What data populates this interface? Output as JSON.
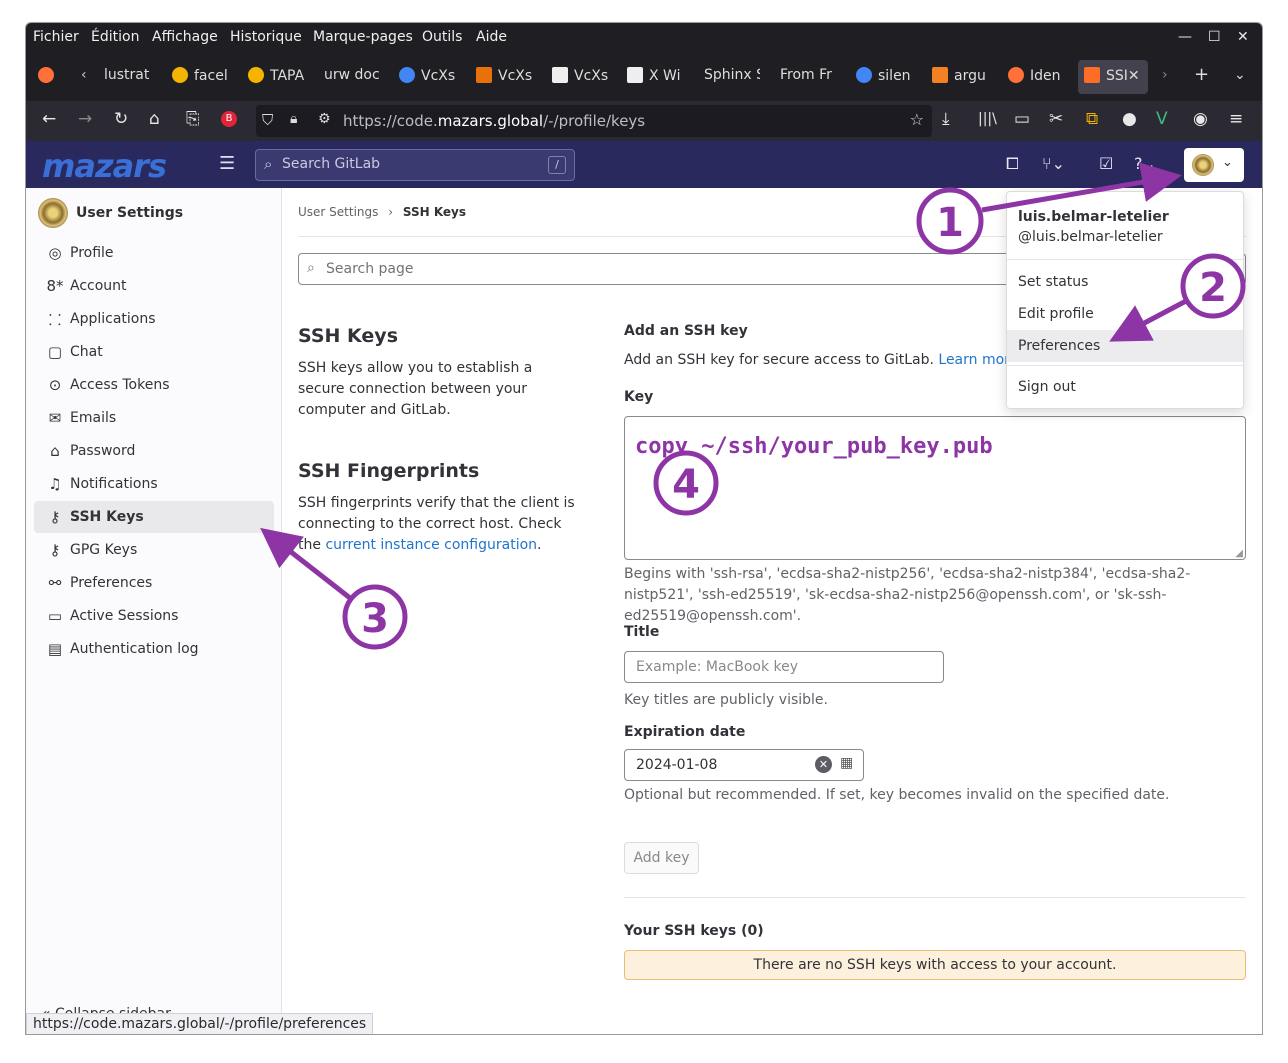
{
  "menubar": {
    "items": [
      "Fichier",
      "Édition",
      "Affichage",
      "Historique",
      "Marque-pages",
      "Outils",
      "Aide"
    ]
  },
  "tabs": [
    {
      "label": "lustrat"
    },
    {
      "label": "facel"
    },
    {
      "label": "TAPA"
    },
    {
      "label": "urw doc"
    },
    {
      "label": "VcXs"
    },
    {
      "label": "VcXs"
    },
    {
      "label": "VcXs"
    },
    {
      "label": "X Wi"
    },
    {
      "label": "Sphinx S"
    },
    {
      "label": "From Fr"
    },
    {
      "label": "silen"
    },
    {
      "label": "argu"
    },
    {
      "label": "Iden"
    },
    {
      "label": "SSI"
    }
  ],
  "url": {
    "prefix": "https://code.",
    "domain": "mazars.global",
    "path": "/-/profile/keys"
  },
  "gitlab": {
    "logo": "mazars",
    "search_placeholder": "Search GitLab",
    "search_shortcut": "/"
  },
  "sidebar": {
    "title": "User Settings",
    "items": [
      {
        "label": "Profile",
        "icon": "user-icon"
      },
      {
        "label": "Account",
        "icon": "account-icon"
      },
      {
        "label": "Applications",
        "icon": "applications-icon"
      },
      {
        "label": "Chat",
        "icon": "chat-icon"
      },
      {
        "label": "Access Tokens",
        "icon": "token-icon"
      },
      {
        "label": "Emails",
        "icon": "email-icon"
      },
      {
        "label": "Password",
        "icon": "lock-icon"
      },
      {
        "label": "Notifications",
        "icon": "bell-icon"
      },
      {
        "label": "SSH Keys",
        "icon": "key-icon"
      },
      {
        "label": "GPG Keys",
        "icon": "key-icon"
      },
      {
        "label": "Preferences",
        "icon": "preferences-icon"
      },
      {
        "label": "Active Sessions",
        "icon": "monitor-icon"
      },
      {
        "label": "Authentication log",
        "icon": "log-icon"
      }
    ],
    "collapse": "Collapse sidebar"
  },
  "breadcrumb": {
    "parent": "User Settings",
    "sep": "›",
    "current": "SSH Keys"
  },
  "search_page": "Search page",
  "ssh_keys_section": {
    "title": "SSH Keys",
    "desc": "SSH keys allow you to establish a secure connection between your computer and GitLab."
  },
  "fingerprints_section": {
    "title": "SSH Fingerprints",
    "desc": "SSH fingerprints verify that the client is connecting to the correct host. Check the",
    "link": "current instance configuration",
    "suffix": "."
  },
  "form": {
    "add_title": "Add an SSH key",
    "add_desc": "Add an SSH key for secure access to GitLab.",
    "learn_more": "Learn more.",
    "key_label": "Key",
    "key_value": "copy ~/ssh/your_pub_key.pub",
    "key_help": "Begins with 'ssh-rsa', 'ecdsa-sha2-nistp256', 'ecdsa-sha2-nistp384', 'ecdsa-sha2-nistp521', 'ssh-ed25519', 'sk-ecdsa-sha2-nistp256@openssh.com', or 'sk-ssh-ed25519@openssh.com'.",
    "title_label": "Title",
    "title_placeholder": "Example: MacBook key",
    "title_help": "Key titles are publicly visible.",
    "exp_label": "Expiration date",
    "exp_value": "2024-01-08",
    "exp_help": "Optional but recommended. If set, key becomes invalid on the specified date.",
    "add_button": "Add key",
    "your_keys": "Your SSH keys (0)",
    "no_keys": "There are no SSH keys with access to your account."
  },
  "dropdown": {
    "name": "luis.belmar-letelier",
    "handle": "@luis.belmar-letelier",
    "items": [
      "Set status",
      "Edit profile",
      "Preferences",
      "Sign out"
    ]
  },
  "annotations": [
    "1",
    "2",
    "3",
    "4"
  ],
  "status_url": "https://code.mazars.global/-/profile/preferences",
  "colors": {
    "annotation": "#8e35a6",
    "header": "#29295e",
    "link": "#1f75cb"
  }
}
